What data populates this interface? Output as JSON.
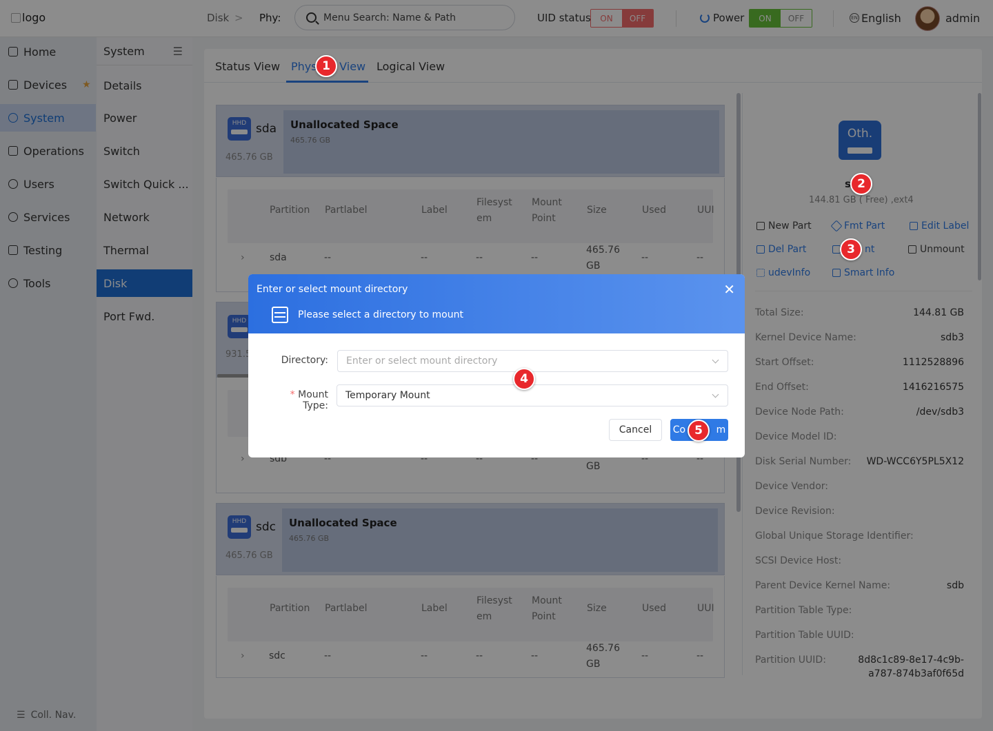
{
  "header": {
    "logo_alt": "logo",
    "breadcrumb_root": "Disk",
    "breadcrumb_sep": ">",
    "breadcrumb_current": "Phy:",
    "search_placeholder": "Menu Search: Name & Path",
    "uid_label": "UID status",
    "uid_on": "ON",
    "uid_off": "OFF",
    "power_label": "Power",
    "power_on": "ON",
    "power_off": "OFF",
    "language": "English",
    "user": "admin"
  },
  "sidebar": {
    "items": [
      {
        "label": "Home"
      },
      {
        "label": "Devices"
      },
      {
        "label": "System"
      },
      {
        "label": "Operations"
      },
      {
        "label": "Users"
      },
      {
        "label": "Services"
      },
      {
        "label": "Testing"
      },
      {
        "label": "Tools"
      }
    ],
    "collapse_label": "Coll. Nav."
  },
  "subnav": {
    "title": "System",
    "items": [
      {
        "label": "Details"
      },
      {
        "label": "Power"
      },
      {
        "label": "Switch"
      },
      {
        "label": "Switch Quick ..."
      },
      {
        "label": "Network"
      },
      {
        "label": "Thermal"
      },
      {
        "label": "Disk"
      },
      {
        "label": "Port Fwd."
      }
    ]
  },
  "tabs": [
    {
      "label": "Status View"
    },
    {
      "label": "Physical View"
    },
    {
      "label": "Logical View"
    }
  ],
  "disks": {
    "sda": {
      "badge": "HHD",
      "name": "sda",
      "size": "465.76 GB",
      "unalloc_title": "Unallocated Space",
      "unalloc_size": "465.76 GB"
    },
    "sdb": {
      "badge": "HHD",
      "size_partial": "931.5",
      "row_name": "sdb",
      "row_size": "GB"
    },
    "sdc": {
      "badge": "HHD",
      "name": "sdc",
      "size": "465.76 GB",
      "unalloc_title": "Unallocated Space",
      "unalloc_size": "465.76 GB"
    }
  },
  "table": {
    "columns": [
      "Partition",
      "Partlabel",
      "Label",
      "Filesyst\nem",
      "Mount\nPoint",
      "Size",
      "Used",
      "UUI"
    ],
    "rows": {
      "sda": [
        "sda",
        "--",
        "--",
        "--",
        "--",
        "465.76\nGB",
        "--",
        "--"
      ],
      "sdc": [
        "sdc",
        "--",
        "--",
        "--",
        "--",
        "465.76\nGB",
        "--",
        "--"
      ],
      "sdb": [
        "sdb",
        "--",
        "--",
        "--",
        "--",
        "GB",
        "--",
        "--"
      ]
    }
  },
  "detail": {
    "icon_text": "Oth.",
    "name": "s",
    "free": "144.81 GB ( Free) ,ext4",
    "actions": {
      "new_part": "New Part",
      "fmt_part": "Fmt Part",
      "edit_label": "Edit Label",
      "del_part": "Del Part",
      "mount": "nt",
      "unmount": "Unmount",
      "udevinfo": "udevInfo",
      "smart_info": "Smart Info"
    },
    "props": [
      {
        "k": "Total Size:",
        "v": "144.81 GB"
      },
      {
        "k": "Kernel Device Name:",
        "v": "sdb3"
      },
      {
        "k": "Start Offset:",
        "v": "1112528896"
      },
      {
        "k": "End Offset:",
        "v": "1416216575"
      },
      {
        "k": "Device Node Path:",
        "v": "/dev/sdb3"
      },
      {
        "k": "Device Model ID:",
        "v": ""
      },
      {
        "k": "Disk Serial Number:",
        "v": "WD-WCC6Y5PL5X12"
      },
      {
        "k": "Device Vendor:",
        "v": ""
      },
      {
        "k": "Device Revision:",
        "v": ""
      },
      {
        "k": "Global Unique Storage Identifier:",
        "v": ""
      },
      {
        "k": "SCSI Device Host:",
        "v": ""
      },
      {
        "k": "Parent Device Kernel Name:",
        "v": "sdb"
      },
      {
        "k": "Partition Table Type:",
        "v": ""
      },
      {
        "k": "Partition Table UUID:",
        "v": ""
      },
      {
        "k": "Partition UUID:",
        "v": "8d8c1c89-8e17-4c9b-\na787-874b3af0f65d"
      }
    ]
  },
  "dialog": {
    "title": "Enter or select mount directory",
    "subtitle": "Please select a directory to mount",
    "close": "✕",
    "directory_label": "Directory:",
    "directory_placeholder": "Enter or select mount directory",
    "mount_type_required": "*",
    "mount_type_label": "Mount Type:",
    "mount_type_value": "Temporary Mount",
    "cancel": "Cancel",
    "confirm": "Co          m"
  },
  "badges": [
    "1",
    "2",
    "3",
    "4",
    "5"
  ],
  "colors": {
    "accent": "#2f7ae5",
    "badge": "#e8282c",
    "uid_off": "#f56c6c",
    "power_on": "#67c23a"
  }
}
